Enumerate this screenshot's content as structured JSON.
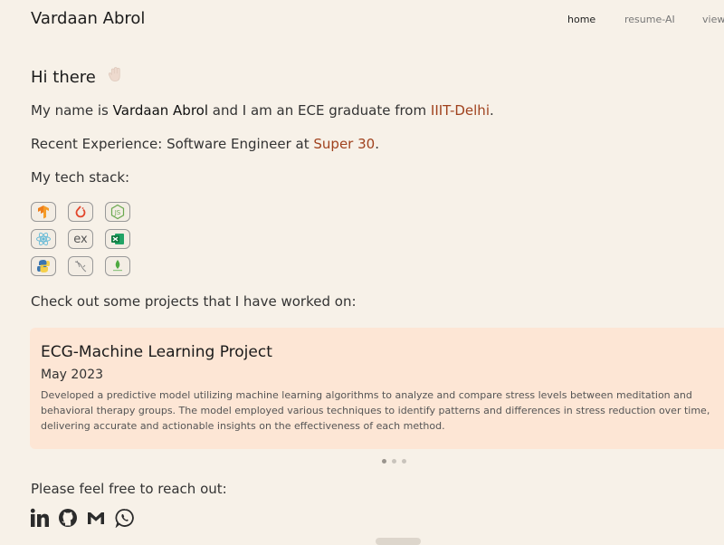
{
  "header": {
    "brand": "Vardaan Abrol",
    "nav": [
      {
        "label": "home",
        "active": true
      },
      {
        "label": "resume-AI",
        "active": false
      },
      {
        "label": "view",
        "active": false
      }
    ]
  },
  "intro": {
    "greeting": "Hi there",
    "wave_icon": "waving-hand-icon",
    "name_line": {
      "prefix": "My name is",
      "name": "Vardaan Abrol",
      "middle": "and I am an ECE graduate from",
      "college": "IIIT-Delhi",
      "suffix": "."
    },
    "experience_line": {
      "prefix": "Recent Experience: Software Engineer at",
      "company": "Super 30",
      "suffix": "."
    },
    "tech_heading": "My tech stack:"
  },
  "tech_stack": {
    "icons": [
      "tensorflow-icon",
      "pytorch-icon",
      "nodejs-icon",
      "react-icon",
      "express-icon",
      "excel-icon",
      "python-icon",
      "mysql-icon",
      "mongodb-icon"
    ],
    "express_label": "ex"
  },
  "projects": {
    "heading": "Check out some projects that I have worked on:",
    "items": [
      {
        "title": "ECG-Machine Learning Project",
        "date": "May 2023",
        "description": "Developed a predictive model utilizing machine learning algorithms to analyze and compare stress levels between meditation and behavioral therapy groups. The model employed various techniques to identify patterns and differences in stress reduction over time, delivering accurate and actionable insights on the effectiveness of each method."
      }
    ],
    "carousel_pages": 3,
    "active_page": 1
  },
  "contact": {
    "heading": "Please feel free to reach out:",
    "icons": [
      "linkedin-icon",
      "github-icon",
      "gmail-icon",
      "whatsapp-icon"
    ]
  },
  "colors": {
    "background": "#f7f1e8",
    "accent": "#a0421e",
    "card": "#fde6d5"
  }
}
